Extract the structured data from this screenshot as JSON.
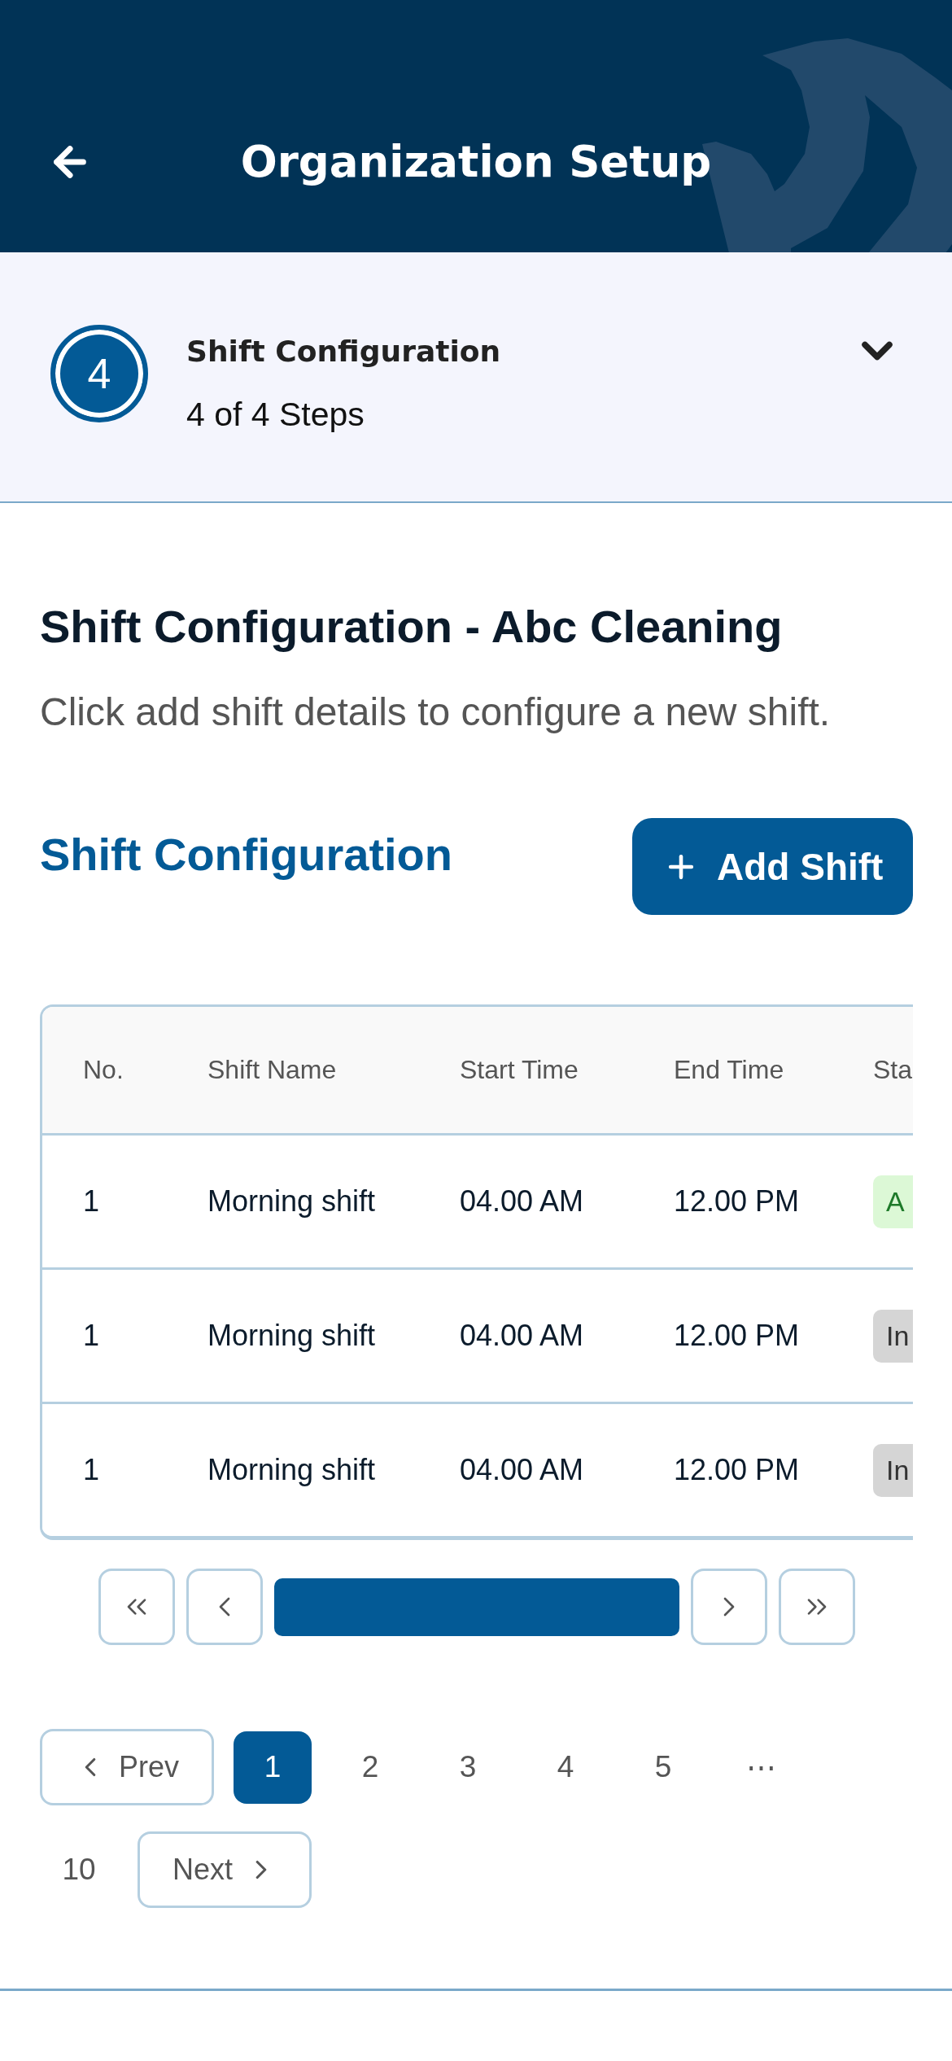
{
  "header": {
    "title": "Organization Setup"
  },
  "stepper": {
    "step_number": "4",
    "title": "Shift Configuration",
    "progress": "4 of 4 Steps",
    "completed": true,
    "expanded": false
  },
  "intro": {
    "title": "Shift Configuration - Abc Cleaning",
    "description": "Click add shift details to configure a new shift."
  },
  "section": {
    "title": "Shift Configuration",
    "add_button": "Add Shift"
  },
  "table": {
    "columns": [
      "No.",
      "Shift Name",
      "Start Time",
      "End Time",
      "Sta"
    ],
    "rows": [
      {
        "cells": [
          "1",
          "Morning shift",
          "04.00 AM",
          "12.00 PM"
        ],
        "status": {
          "label": "A",
          "kind": "active"
        }
      },
      {
        "cells": [
          "1",
          "Morning shift",
          "04.00 AM",
          "12.00 PM"
        ],
        "status": {
          "label": "In",
          "kind": "inactive"
        }
      },
      {
        "cells": [
          "1",
          "Morning shift",
          "04.00 AM",
          "12.00 PM"
        ],
        "status": {
          "label": "In",
          "kind": "inactive"
        }
      }
    ]
  },
  "pagination": {
    "prev": "Prev",
    "next": "Next",
    "pages": [
      {
        "label": "1",
        "selected": true
      },
      {
        "label": "2",
        "selected": false
      },
      {
        "label": "3",
        "selected": false
      },
      {
        "label": "4",
        "selected": false
      },
      {
        "label": "5",
        "selected": false
      },
      {
        "label": "⋯",
        "selected": false
      },
      {
        "label": "10",
        "selected": false
      }
    ]
  }
}
